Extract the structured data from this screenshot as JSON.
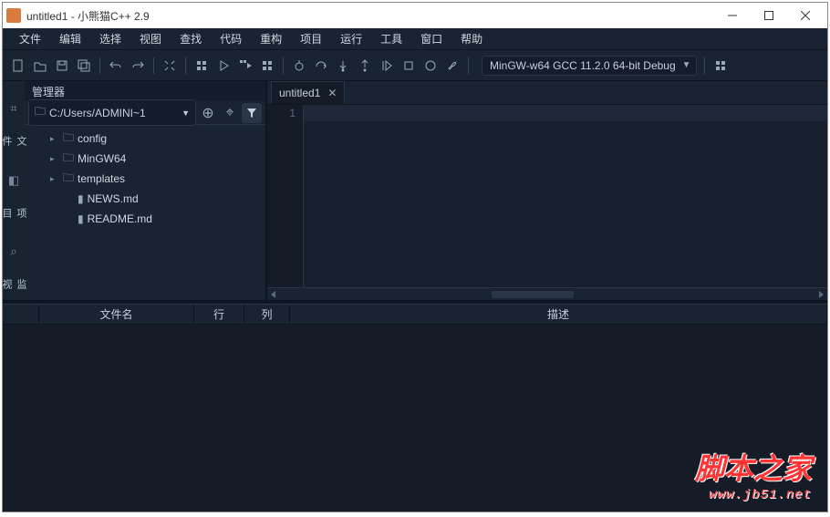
{
  "window": {
    "title": "untitled1 - 小熊猫C++ 2.9"
  },
  "menu": {
    "items": [
      "文件",
      "编辑",
      "选择",
      "视图",
      "查找",
      "代码",
      "重构",
      "项目",
      "运行",
      "工具",
      "窗口",
      "帮助"
    ]
  },
  "toolbar": {
    "compiler": "MinGW-w64 GCC 11.2.0 64-bit Debug"
  },
  "sidebar": {
    "panel_title": "管理器",
    "vtabs": [
      "文件",
      "项目",
      "监视"
    ],
    "path": "C:/Users/ADMINI~1",
    "tree": [
      {
        "type": "folder",
        "name": "config",
        "depth": 1,
        "expandable": true
      },
      {
        "type": "folder",
        "name": "MinGW64",
        "depth": 1,
        "expandable": true
      },
      {
        "type": "folder",
        "name": "templates",
        "depth": 1,
        "expandable": true
      },
      {
        "type": "file",
        "name": "NEWS.md",
        "depth": 2,
        "expandable": false
      },
      {
        "type": "file",
        "name": "README.md",
        "depth": 2,
        "expandable": false
      }
    ]
  },
  "editor": {
    "tab_name": "untitled1",
    "line_number": "1"
  },
  "bottom_table": {
    "headers": {
      "file": "文件名",
      "line": "行",
      "col": "列",
      "desc": "描述"
    }
  },
  "watermark": {
    "text": "脚本之家",
    "url": "www.jb51.net"
  }
}
